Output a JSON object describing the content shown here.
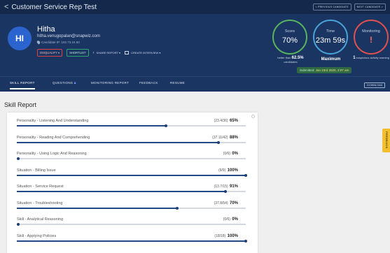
{
  "topbar": {
    "back_glyph": "<",
    "title": "Customer Service Rep Test",
    "prev_label": "< PREVIOUS CANDIDATE",
    "next_label": "NEXT CANDIDATE >"
  },
  "candidate": {
    "initials": "HI",
    "name": "Hitha",
    "email": "hitha.venugopalan@snapwiz.com",
    "ip_label": "Candidate IP: 182.73.24.50"
  },
  "actions": {
    "disqualify": "DISQUALIFY ▾",
    "shortlist": "SHORTLIST",
    "share": "SHARE REPORT ▾",
    "create_interview": "CREATE INTERVIEW ▾"
  },
  "metrics": {
    "score": {
      "label": "Score",
      "value": "70%",
      "sub_prefix": "better than",
      "sub_value": "62.5%",
      "sub_suffix": "candidates",
      "color": "#58b45d"
    },
    "time": {
      "label": "Time",
      "value": "23m 59s",
      "sub": "Maximum",
      "color": "#4aa3d8"
    },
    "monitoring": {
      "label": "Monitoring",
      "value": "!",
      "sub_value": "1",
      "sub_text": "suspicious activity warning",
      "color": "#e2514e"
    }
  },
  "submitted": {
    "prefix": "Submitted:",
    "date": "Jan 23rd 2020, 2:07 am"
  },
  "tabs": [
    {
      "label": "SKILL REPORT"
    },
    {
      "label": "QUESTIONS"
    },
    {
      "label": "MONITORING REPORT"
    },
    {
      "label": "FEEDBACK"
    },
    {
      "label": "RESUME"
    }
  ],
  "download_label": "DOWNLOAD",
  "section_title": "Skill Report",
  "skills": [
    {
      "name": "Personality - Listening And Understanding",
      "ratio": "(23.4/36)",
      "pct": "65%",
      "fraction": 0.65
    },
    {
      "name": "Personality - Reading And Comprehending",
      "ratio": "(37.11/42)",
      "pct": "88%",
      "fraction": 0.88
    },
    {
      "name": "Personality - Using Logic And Reasoning",
      "ratio": "(0/6)",
      "pct": "0%",
      "fraction": 0.0
    },
    {
      "name": "Situation - Billing Issue",
      "ratio": "(9/9)",
      "pct": "100%",
      "fraction": 1.0
    },
    {
      "name": "Situation - Service Request",
      "ratio": "(13.7/15)",
      "pct": "91%",
      "fraction": 0.91
    },
    {
      "name": "Situation - Troubleshooting",
      "ratio": "(37.8/54)",
      "pct": "70%",
      "fraction": 0.7
    },
    {
      "name": "Skill - Analytical Reasoning",
      "ratio": "(0/6)",
      "pct": "0%",
      "fraction": 0.0
    },
    {
      "name": "Skill - Applying Policies",
      "ratio": "(18/18)",
      "pct": "100%",
      "fraction": 1.0
    }
  ],
  "feedback_tab": "FEEDBACK",
  "colors": {
    "topbar": "#13284a",
    "header": "#1b3563",
    "bar_fill": "#244a86",
    "feedback_tab": "#f2bf2e"
  }
}
